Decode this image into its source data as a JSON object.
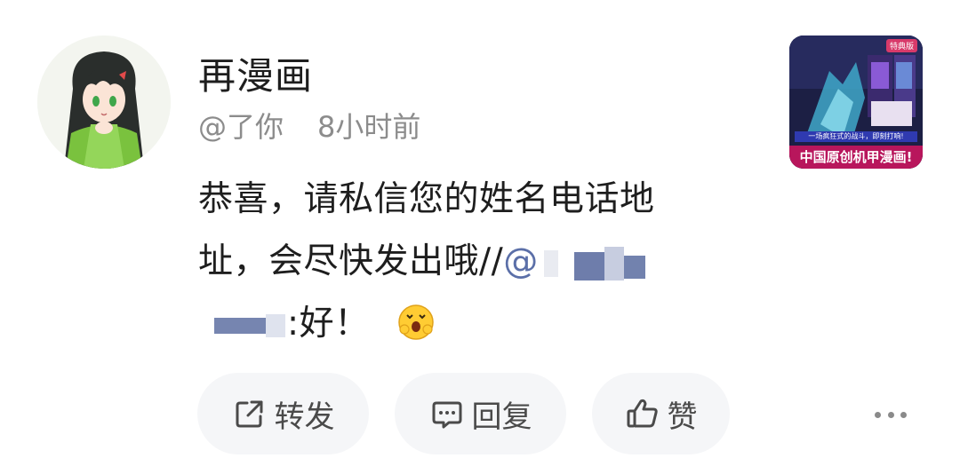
{
  "post": {
    "username": "再漫画",
    "handle": "@了你",
    "time": "8小时前",
    "content": {
      "line1": "恭喜，请私信您的姓名电话地",
      "line2_text": "址，会尽快发出哦//",
      "mention_prefix": "@",
      "line3_text": ":好！"
    }
  },
  "thumbnail": {
    "badge": "特典版",
    "tagline": "一场疯狂式的战斗，即刻打响!",
    "banner": "中国原创机甲漫画!"
  },
  "actions": {
    "share_label": "转发",
    "reply_label": "回复",
    "like_label": "赞"
  },
  "icons": {
    "share": "share-icon",
    "reply": "comment-icon",
    "like": "thumbs-up-icon",
    "more": "more-dots-icon",
    "emoji": "surprised-emoji"
  },
  "colors": {
    "mention": "#5b6fa8",
    "meta_text": "#8c8c8c",
    "button_bg": "#f5f6f8",
    "thumbnail_banner": "#b8165c"
  }
}
